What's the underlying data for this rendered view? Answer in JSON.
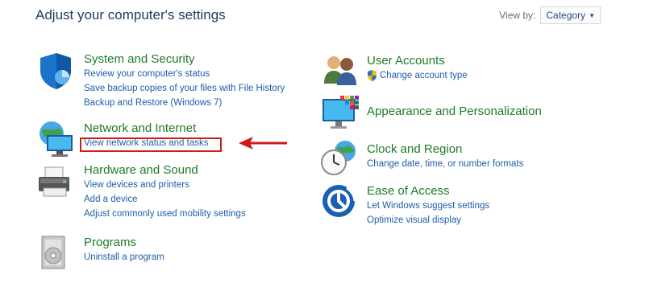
{
  "header": {
    "title": "Adjust your computer's settings",
    "view_by_label": "View by:",
    "view_by_value": "Category"
  },
  "categories_left": [
    {
      "title": "System and Security",
      "icon": "shield-icon",
      "links": [
        "Review your computer's status",
        "Save backup copies of your files with File History",
        "Backup and Restore (Windows 7)"
      ]
    },
    {
      "title": "Network and Internet",
      "icon": "network-globe-icon",
      "links": [
        "View network status and tasks"
      ]
    },
    {
      "title": "Hardware and Sound",
      "icon": "printer-icon",
      "links": [
        "View devices and printers",
        "Add a device",
        "Adjust commonly used mobility settings"
      ]
    },
    {
      "title": "Programs",
      "icon": "programs-disc-icon",
      "links": [
        "Uninstall a program"
      ]
    }
  ],
  "categories_right": [
    {
      "title": "User Accounts",
      "icon": "users-icon",
      "links": [
        "Change account type"
      ]
    },
    {
      "title": "Appearance and Personalization",
      "icon": "monitor-palette-icon",
      "links": []
    },
    {
      "title": "Clock and Region",
      "icon": "clock-globe-icon",
      "links": [
        "Change date, time, or number formats"
      ]
    },
    {
      "title": "Ease of Access",
      "icon": "ease-of-access-icon",
      "links": [
        "Let Windows suggest settings",
        "Optimize visual display"
      ]
    }
  ],
  "colors": {
    "category_title": "#1e7a28",
    "link": "#1f5da8",
    "highlight": "#d11a1a"
  }
}
